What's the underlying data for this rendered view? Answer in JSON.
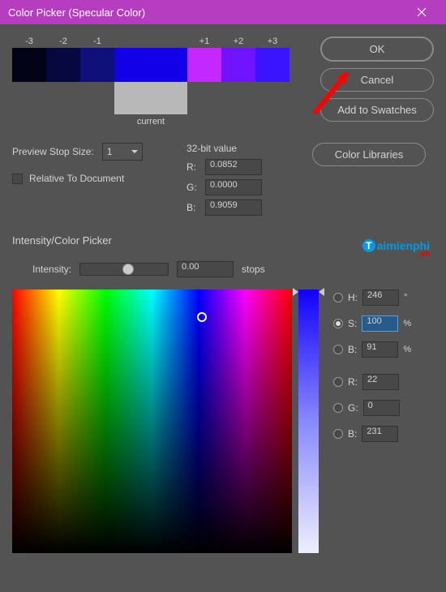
{
  "titlebar": {
    "title": "Color Picker (Specular Color)"
  },
  "swatches": {
    "labels": [
      "-3",
      "-2",
      "-1",
      "+1",
      "+2",
      "+3"
    ],
    "colors": [
      "#030318",
      "#080840",
      "#10107a",
      "#c428ff",
      "#7014ff",
      "#3a14ff"
    ],
    "big_color": "#1100e8",
    "current_color": "#b8b8b8",
    "current_label": "current"
  },
  "buttons": {
    "ok": "OK",
    "cancel": "Cancel",
    "add_swatches": "Add to Swatches",
    "color_libraries": "Color Libraries"
  },
  "preview": {
    "label": "Preview Stop Size:",
    "value": "1",
    "relative_label": "Relative To Document",
    "relative_checked": false
  },
  "bit32": {
    "title": "32-bit value",
    "r_label": "R:",
    "r_value": "0.0852",
    "g_label": "G:",
    "g_value": "0.0000",
    "b_label": "B:",
    "b_value": "0.9059"
  },
  "intensity": {
    "section_title": "Intensity/Color Picker",
    "label": "Intensity:",
    "value": "0.00",
    "unit": "stops"
  },
  "hsb": {
    "h_label": "H:",
    "h_value": "246",
    "h_unit": "°",
    "s_label": "S:",
    "s_value": "100",
    "s_unit": "%",
    "b_label": "B:",
    "b_value": "91",
    "b_unit": "%",
    "r_label": "R:",
    "r_value": "22",
    "g_label": "G:",
    "g_value": "0",
    "bb_label": "B:",
    "bb_value": "231",
    "selected": "S"
  },
  "watermark": {
    "text": "aimienphi",
    "suffix": ".vn"
  }
}
